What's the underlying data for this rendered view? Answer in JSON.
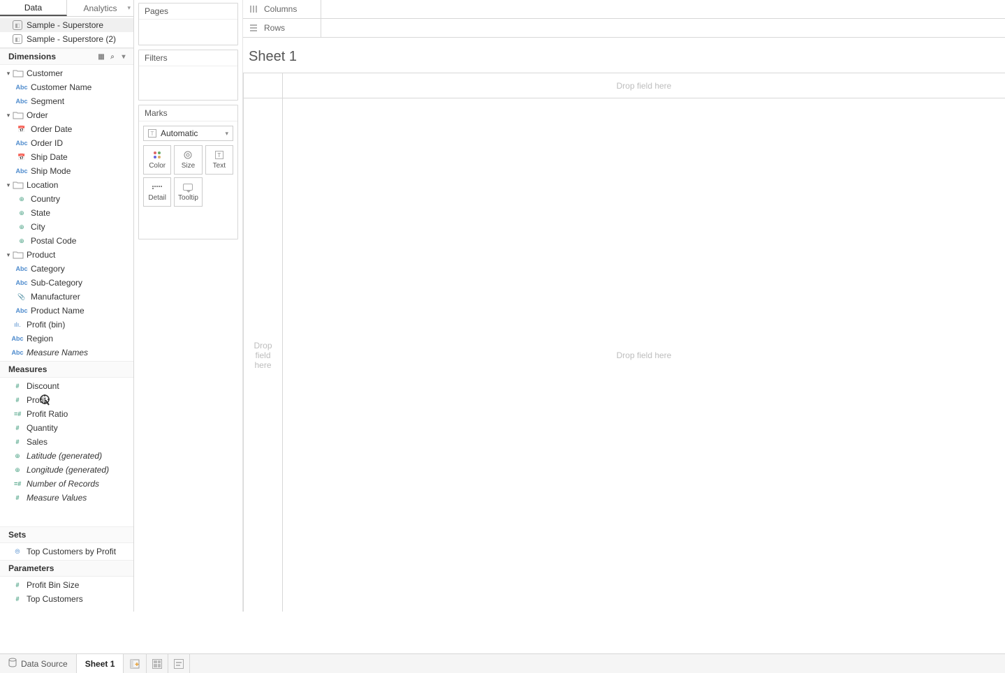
{
  "tabs": {
    "data": "Data",
    "analytics": "Analytics"
  },
  "datasources": [
    {
      "name": "Sample - Superstore",
      "selected": true
    },
    {
      "name": "Sample - Superstore (2)",
      "selected": false
    }
  ],
  "sections": {
    "dimensions": "Dimensions",
    "measures": "Measures",
    "sets": "Sets",
    "parameters": "Parameters"
  },
  "dimensions": {
    "folders": [
      {
        "name": "Customer",
        "fields": [
          {
            "label": "Customer Name",
            "type": "abc"
          },
          {
            "label": "Segment",
            "type": "abc"
          }
        ]
      },
      {
        "name": "Order",
        "fields": [
          {
            "label": "Order Date",
            "type": "date"
          },
          {
            "label": "Order ID",
            "type": "abc"
          },
          {
            "label": "Ship Date",
            "type": "date"
          },
          {
            "label": "Ship Mode",
            "type": "abc"
          }
        ]
      },
      {
        "name": "Location",
        "fields": [
          {
            "label": "Country",
            "type": "geo"
          },
          {
            "label": "State",
            "type": "geo"
          },
          {
            "label": "City",
            "type": "geo"
          },
          {
            "label": "Postal Code",
            "type": "geo"
          }
        ]
      },
      {
        "name": "Product",
        "fields": [
          {
            "label": "Category",
            "type": "abc"
          },
          {
            "label": "Sub-Category",
            "type": "abc"
          },
          {
            "label": "Manufacturer",
            "type": "clip"
          },
          {
            "label": "Product Name",
            "type": "abc"
          }
        ]
      }
    ],
    "loose": [
      {
        "label": "Profit (bin)",
        "type": "bin"
      },
      {
        "label": "Region",
        "type": "abc"
      },
      {
        "label": "Measure Names",
        "type": "abc",
        "italic": true
      }
    ]
  },
  "measures": [
    {
      "label": "Discount",
      "type": "num"
    },
    {
      "label": "Profit",
      "type": "num"
    },
    {
      "label": "Profit Ratio",
      "type": "numc"
    },
    {
      "label": "Quantity",
      "type": "num"
    },
    {
      "label": "Sales",
      "type": "num"
    },
    {
      "label": "Latitude (generated)",
      "type": "geo",
      "italic": true
    },
    {
      "label": "Longitude (generated)",
      "type": "geo",
      "italic": true
    },
    {
      "label": "Number of Records",
      "type": "numc",
      "italic": true
    },
    {
      "label": "Measure Values",
      "type": "num",
      "italic": true
    }
  ],
  "sets": [
    {
      "label": "Top Customers by Profit",
      "type": "set"
    }
  ],
  "parameters": [
    {
      "label": "Profit Bin Size",
      "type": "num"
    },
    {
      "label": "Top Customers",
      "type": "num"
    }
  ],
  "cards": {
    "pages": "Pages",
    "filters": "Filters",
    "marks": "Marks"
  },
  "marks": {
    "dropdown": "Automatic",
    "buttons": {
      "color": "Color",
      "size": "Size",
      "text": "Text",
      "detail": "Detail",
      "tooltip": "Tooltip"
    }
  },
  "shelves": {
    "columns": "Columns",
    "rows": "Rows"
  },
  "sheet": {
    "title": "Sheet 1",
    "drop": "Drop field here",
    "dropcol": "Drop\nfield\nhere"
  },
  "bottom": {
    "datasource": "Data Source",
    "sheet1": "Sheet 1"
  }
}
